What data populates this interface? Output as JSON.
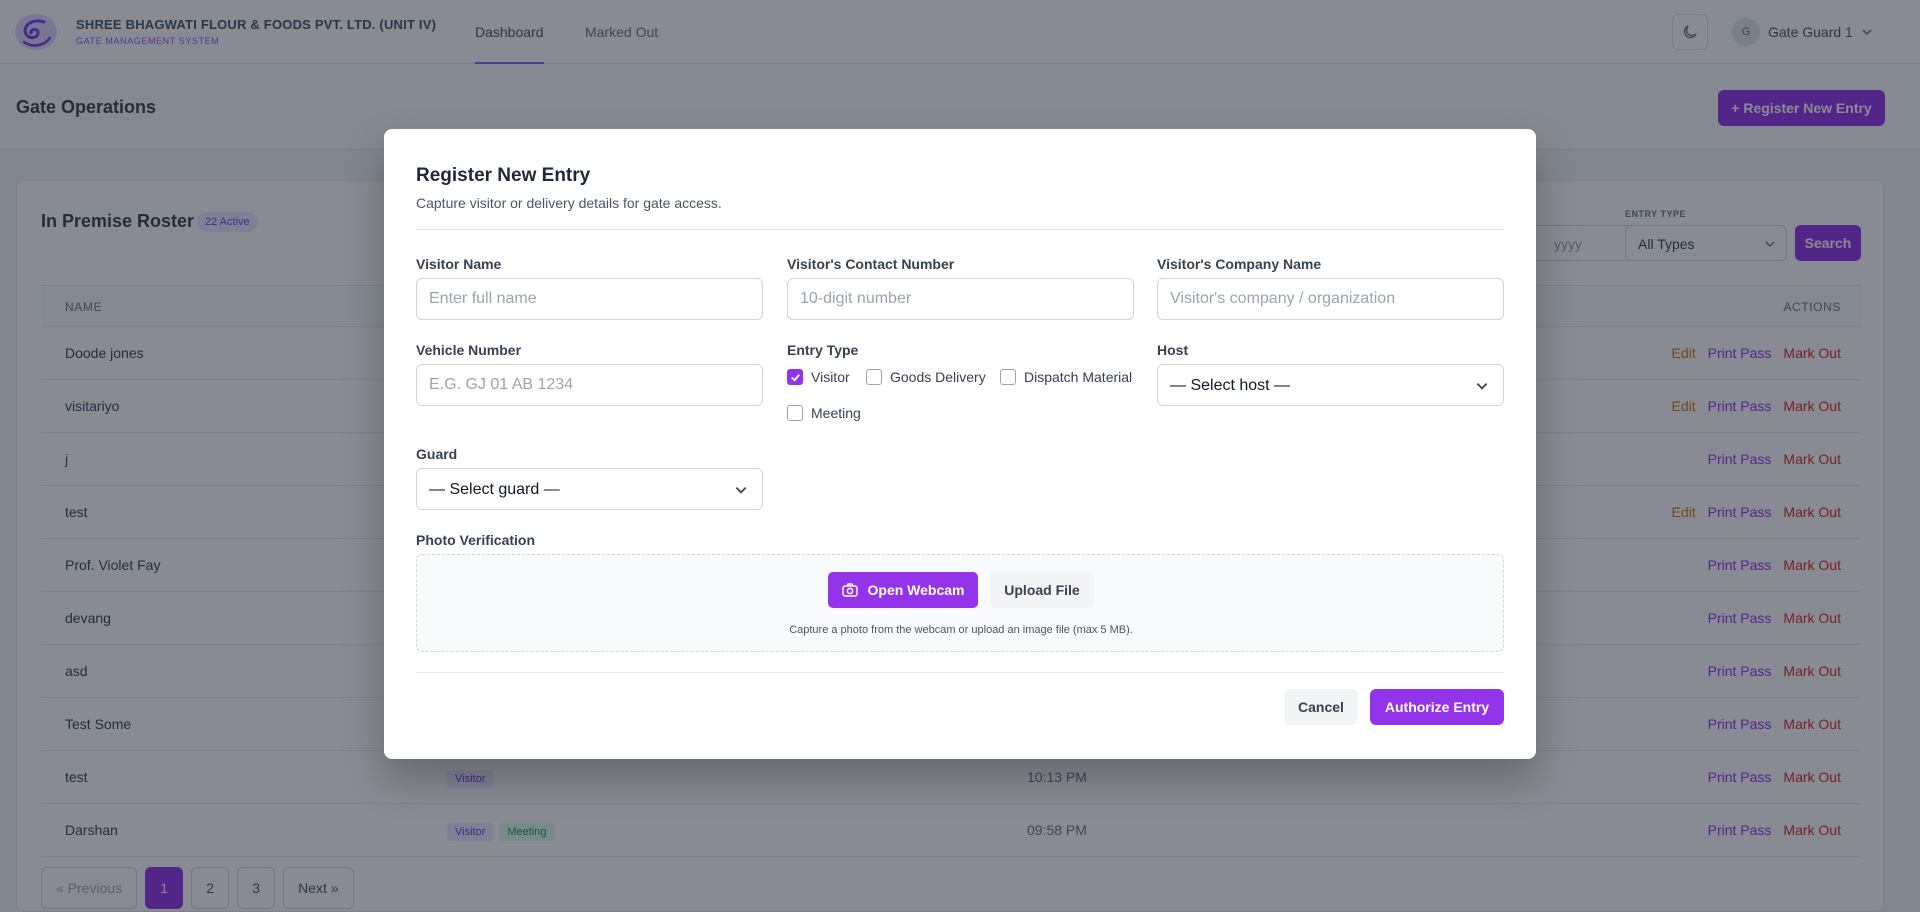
{
  "brand": {
    "title": "SHREE BHAGWATI FLOUR & FOODS PVT. LTD. (UNIT IV)",
    "subtitle": "GATE MANAGEMENT SYSTEM"
  },
  "nav": {
    "tabs": [
      {
        "label": "Dashboard",
        "active": true
      },
      {
        "label": "Marked Out",
        "active": false
      }
    ],
    "user": {
      "initial": "G",
      "name": "Gate Guard 1"
    }
  },
  "page": {
    "title": "Gate Operations",
    "register_button": "+ Register New Entry"
  },
  "roster": {
    "title": "In Premise Roster",
    "active_badge": "22 Active",
    "filters": {
      "date_placeholder": "yyyy",
      "entry_type_label": "ENTRY TYPE",
      "entry_type_value": "All Types",
      "search_button": "Search"
    },
    "columns": {
      "name": "NAME",
      "actions": "ACTIONS"
    },
    "action_labels": {
      "edit": "Edit",
      "print": "Print Pass",
      "mark": "Mark Out"
    },
    "rows": [
      {
        "name": "Doode jones",
        "edit": true,
        "badges": [],
        "time": ""
      },
      {
        "name": "visitariyo",
        "edit": true,
        "badges": [],
        "time": ""
      },
      {
        "name": "j",
        "edit": false,
        "badges": [],
        "time": ""
      },
      {
        "name": "test",
        "edit": true,
        "badges": [],
        "time": ""
      },
      {
        "name": "Prof. Violet Fay",
        "edit": false,
        "badges": [],
        "time": ""
      },
      {
        "name": "devang",
        "edit": false,
        "badges": [],
        "time": ""
      },
      {
        "name": "asd",
        "edit": false,
        "badges": [],
        "time": ""
      },
      {
        "name": "Test Some",
        "edit": false,
        "badges": [],
        "time": ""
      },
      {
        "name": "test",
        "edit": false,
        "badges": [
          "Visitor"
        ],
        "time": "10:13 PM"
      },
      {
        "name": "Darshan",
        "edit": false,
        "badges": [
          "Visitor",
          "Meeting"
        ],
        "time": "09:58 PM"
      }
    ],
    "pagination": {
      "previous": "« Previous",
      "pages": [
        "1",
        "2",
        "3"
      ],
      "current": "1",
      "next": "Next »"
    }
  },
  "modal": {
    "title": "Register New Entry",
    "subtitle": "Capture visitor or delivery details for gate access.",
    "fields": {
      "visitor_name": {
        "label": "Visitor Name",
        "placeholder": "Enter full name"
      },
      "contact": {
        "label": "Visitor's Contact Number",
        "placeholder": "10-digit number"
      },
      "company": {
        "label": "Visitor's Company Name",
        "placeholder": "Visitor's company / organization"
      },
      "vehicle": {
        "label": "Vehicle Number",
        "placeholder": "E.G. GJ 01 AB 1234"
      },
      "entry_type": {
        "label": "Entry Type",
        "options": [
          {
            "label": "Visitor",
            "checked": true
          },
          {
            "label": "Goods Delivery",
            "checked": false
          },
          {
            "label": "Dispatch Material",
            "checked": false
          },
          {
            "label": "Meeting",
            "checked": false
          }
        ]
      },
      "host": {
        "label": "Host",
        "value": "— Select host —"
      },
      "guard": {
        "label": "Guard",
        "value": "— Select guard —"
      }
    },
    "photo": {
      "label": "Photo Verification",
      "webcam_button": "Open Webcam",
      "upload_button": "Upload File",
      "hint": "Capture a photo from the webcam or upload an image file (max 5 MB)."
    },
    "cancel_button": "Cancel",
    "authorize_button": "Authorize Entry"
  },
  "colors": {
    "accent": "#9333ea",
    "edit": "#d97706",
    "mark_out": "#dc2626",
    "overlay": "#111827"
  }
}
